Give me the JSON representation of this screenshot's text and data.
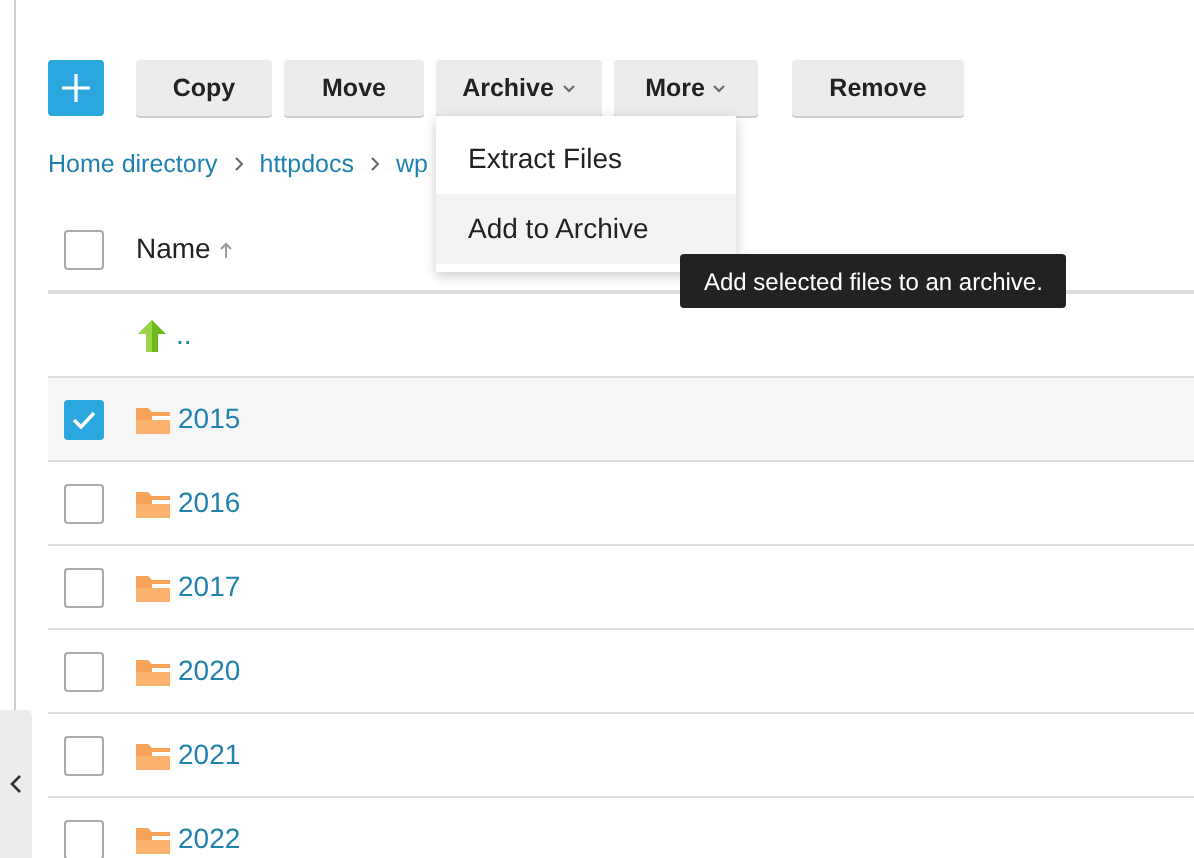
{
  "toolbar": {
    "buttons": [
      {
        "label": "Copy",
        "kind": "button"
      },
      {
        "label": "Move",
        "kind": "button"
      },
      {
        "label": "Archive",
        "kind": "dropdown",
        "expanded": true
      },
      {
        "label": "More",
        "kind": "dropdown",
        "expanded": false
      },
      {
        "label": "Remove",
        "kind": "button"
      }
    ]
  },
  "archive_menu": {
    "items": [
      {
        "label": "Extract Files",
        "selected": false
      },
      {
        "label": "Add to Archive",
        "selected": true
      }
    ]
  },
  "tooltip": {
    "text": "Add selected files to an archive."
  },
  "breadcrumb": [
    "Home directory",
    "httpdocs",
    "wp"
  ],
  "table": {
    "columns": [
      {
        "label": "Name",
        "sorted_ascending": true
      }
    ],
    "header_checked": false,
    "rows": [
      {
        "name": "..",
        "kind": "parent"
      },
      {
        "name": "2015",
        "kind": "folder",
        "checked": true
      },
      {
        "name": "2016",
        "kind": "folder",
        "checked": false
      },
      {
        "name": "2017",
        "kind": "folder",
        "checked": false
      },
      {
        "name": "2020",
        "kind": "folder",
        "checked": false
      },
      {
        "name": "2021",
        "kind": "folder",
        "checked": false
      },
      {
        "name": "2022",
        "kind": "folder",
        "checked": false
      }
    ]
  }
}
